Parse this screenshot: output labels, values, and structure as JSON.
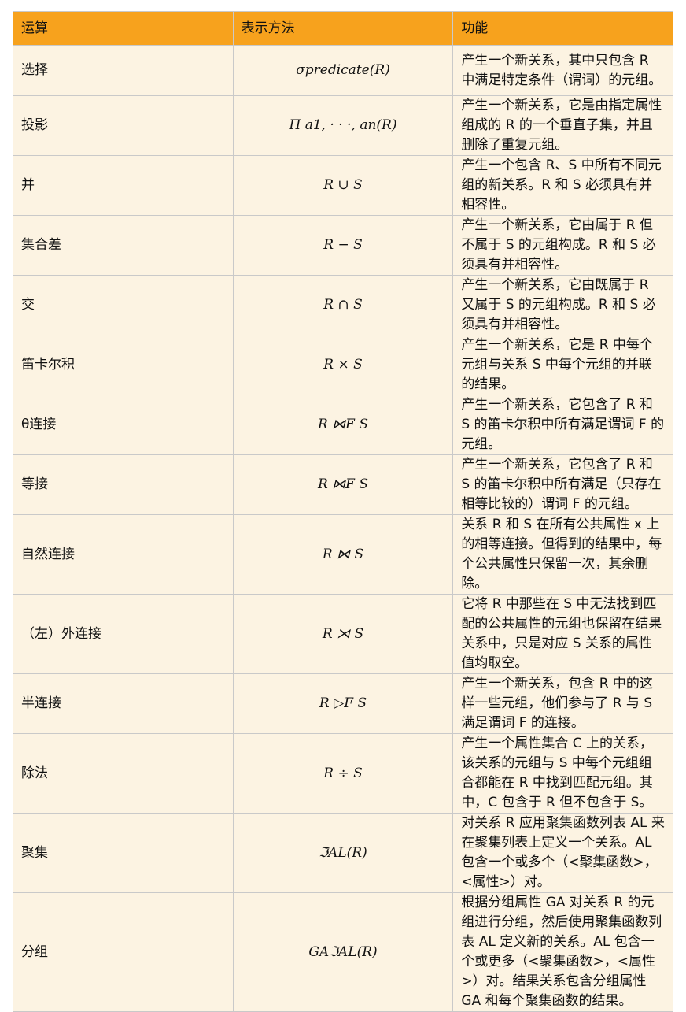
{
  "header": {
    "op": "运算",
    "notation": "表示方法",
    "function": "功能"
  },
  "rows": [
    {
      "op": "选择",
      "notation": "σpredicate(R)",
      "desc": "产生一个新关系，其中只包含 R 中满足特定条件（谓词）的元组。"
    },
    {
      "op": "投影",
      "notation": "Π a1, · · ·, an(R)",
      "desc": "产生一个新关系，它是由指定属性组成的 R 的一个垂直子集，并且删除了重复元组。"
    },
    {
      "op": "并",
      "notation": "R ∪ S",
      "desc": "产生一个包含 R、S 中所有不同元组的新关系。R 和 S 必须具有并相容性。"
    },
    {
      "op": "集合差",
      "notation": "R − S",
      "desc": "产生一个新关系，它由属于 R 但不属于 S 的元组构成。R 和 S 必须具有并相容性。"
    },
    {
      "op": "交",
      "notation": "R ∩ S",
      "desc": "产生一个新关系，它由既属于 R 又属于 S 的元组构成。R 和 S 必须具有并相容性。"
    },
    {
      "op": "笛卡尔积",
      "notation": "R × S",
      "desc": "产生一个新关系，它是 R 中每个元组与关系 S 中每个元组的并联的结果。"
    },
    {
      "op": "θ连接",
      "notation": "R ⋈F S",
      "desc": "产生一个新关系，它包含了 R 和 S 的笛卡尔积中所有满足谓词 F 的元组。"
    },
    {
      "op": "等接",
      "notation": "R ⋈F S",
      "desc": "产生一个新关系，它包含了 R 和 S 的笛卡尔积中所有满足（只存在相等比较的）谓词 F 的元组。"
    },
    {
      "op": "自然连接",
      "notation": "R ⋈ S",
      "desc": "关系 R 和 S 在所有公共属性 x 上的相等连接。但得到的结果中，每个公共属性只保留一次，其余删除。"
    },
    {
      "op": "（左）外连接",
      "notation": "R ⋊ S",
      "desc": "它将 R 中那些在 S 中无法找到匹配的公共属性的元组也保留在结果关系中，只是对应 S 关系的属性值均取空。"
    },
    {
      "op": "半连接",
      "notation": "R ▷F S",
      "desc": "产生一个新关系，包含 R 中的这样一些元组，他们参与了 R 与 S 满足谓词 F 的连接。"
    },
    {
      "op": "除法",
      "notation": "R ÷ S",
      "desc": "产生一个属性集合 C 上的关系，该关系的元组与 S 中每个元组组合都能在 R 中找到匹配元组。其中，C 包含于 R 但不包含于 S。"
    },
    {
      "op": "聚集",
      "notation": "ℑAL(R)",
      "desc": "对关系 R 应用聚集函数列表 AL 来在聚集列表上定义一个关系。AL 包含一个或多个（<聚集函数>，<属性>）对。"
    },
    {
      "op": "分组",
      "notation": "GAℑAL(R)",
      "desc": "根据分组属性 GA 对关系 R 的元组进行分组，然后使用聚集函数列表 AL 定义新的关系。AL 包含一个或更多（<聚集函数>，<属性>）对。结果关系包含分组属性 GA 和每个聚集函数的结果。"
    }
  ]
}
